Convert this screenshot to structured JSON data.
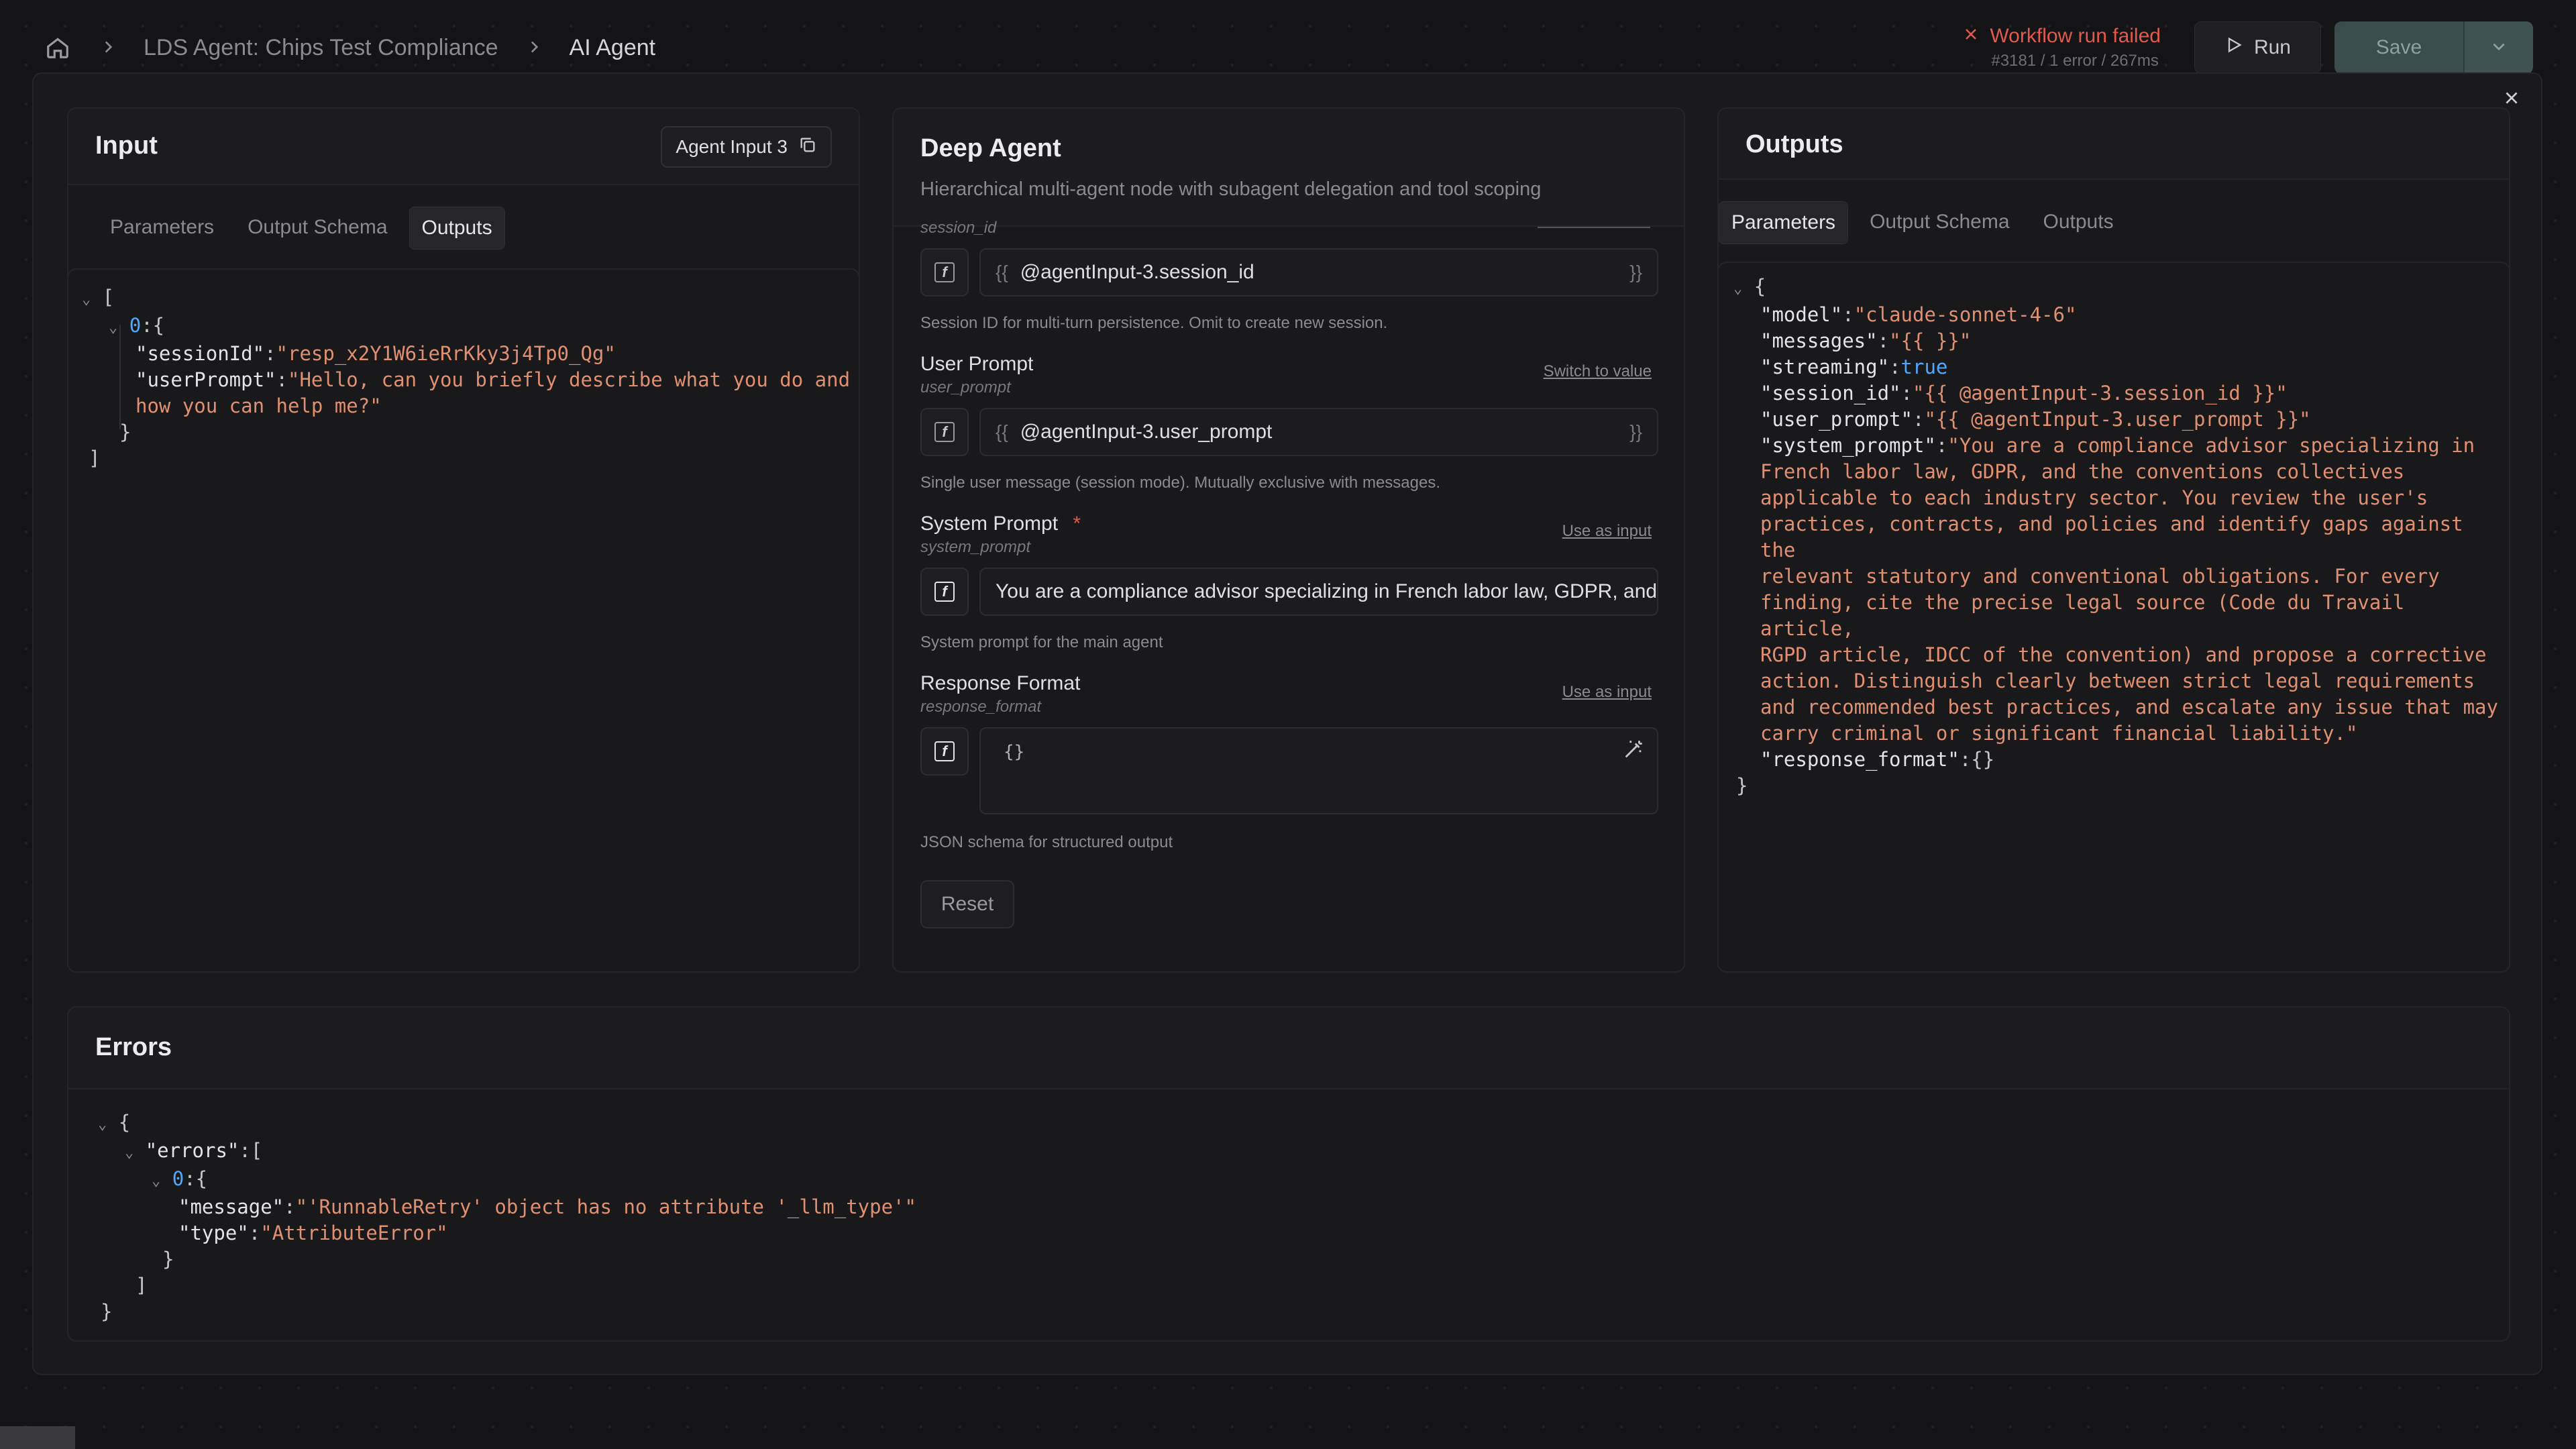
{
  "breadcrumb": {
    "home_icon": "home-icon",
    "workflow": "LDS Agent: Chips Test Compliance",
    "node": "AI Agent"
  },
  "run_status": {
    "title": "Workflow run failed",
    "detail": "#3181 / 1 error / 267ms",
    "color": "#e05a4e"
  },
  "toolbar": {
    "run_label": "Run",
    "save_label": "Save"
  },
  "input_panel": {
    "title": "Input",
    "agent_select": "Agent Input 3",
    "tabs": [
      "Parameters",
      "Output Schema",
      "Outputs"
    ],
    "active_tab": "Outputs",
    "json": {
      "sessionId": "\"resp_x2Y1W6ieRrKky3j4Tp0_Qg\"",
      "userPrompt_1": "\"Hello, can you briefly describe what you do and",
      "userPrompt_2": "how you can help me?\""
    }
  },
  "deep_agent": {
    "title": "Deep Agent",
    "subtitle": "Hierarchical multi-agent node with subagent delegation and tool scoping",
    "session": {
      "sub": "session_id",
      "value": "@agentInput-3.session_id",
      "help": "Session ID for multi-turn persistence. Omit to create new session."
    },
    "user_prompt": {
      "label": "User Prompt",
      "sub": "user_prompt",
      "action": "Switch to value",
      "value": "@agentInput-3.user_prompt",
      "help": "Single user message (session mode). Mutually exclusive with messages."
    },
    "system_prompt": {
      "label": "System Prompt",
      "required": "*",
      "sub": "system_prompt",
      "action": "Use as input",
      "value": "You are a compliance advisor specializing in French labor law, GDPR, and",
      "help": "System prompt for the main agent"
    },
    "response_format": {
      "label": "Response Format",
      "sub": "response_format",
      "action": "Use as input",
      "value": "{}",
      "help": "JSON schema for structured output"
    },
    "reset_label": "Reset",
    "brace_open": "{{",
    "brace_close": "}}"
  },
  "outputs_panel": {
    "title": "Outputs",
    "tabs": [
      "Parameters",
      "Output Schema",
      "Outputs"
    ],
    "active_tab": "Parameters",
    "json": {
      "model": "\"claude-sonnet-4-6\"",
      "messages": "\"{{ }}\"",
      "streaming": "true",
      "session_id": "\"{{ @agentInput-3.session_id }}\"",
      "user_prompt": "\"{{ @agentInput-3.user_prompt }}\"",
      "system_prompt_lines": [
        "\"You are a compliance advisor specializing in",
        "French labor law, GDPR, and the conventions collectives",
        "applicable to each industry sector. You review the user's",
        "practices, contracts, and policies and identify gaps against the",
        "relevant statutory and conventional obligations. For every",
        "finding, cite the precise legal source (Code du Travail article,",
        "RGPD article, IDCC of the convention) and propose a corrective",
        "action. Distinguish clearly between strict legal requirements",
        "and recommended best practices, and escalate any issue that may",
        "carry criminal or significant financial liability.\""
      ],
      "response_format": "{}"
    }
  },
  "errors_panel": {
    "title": "Errors",
    "message": "\"'RunnableRetry' object has no attribute '_llm_type'\"",
    "type": "\"AttributeError\""
  }
}
